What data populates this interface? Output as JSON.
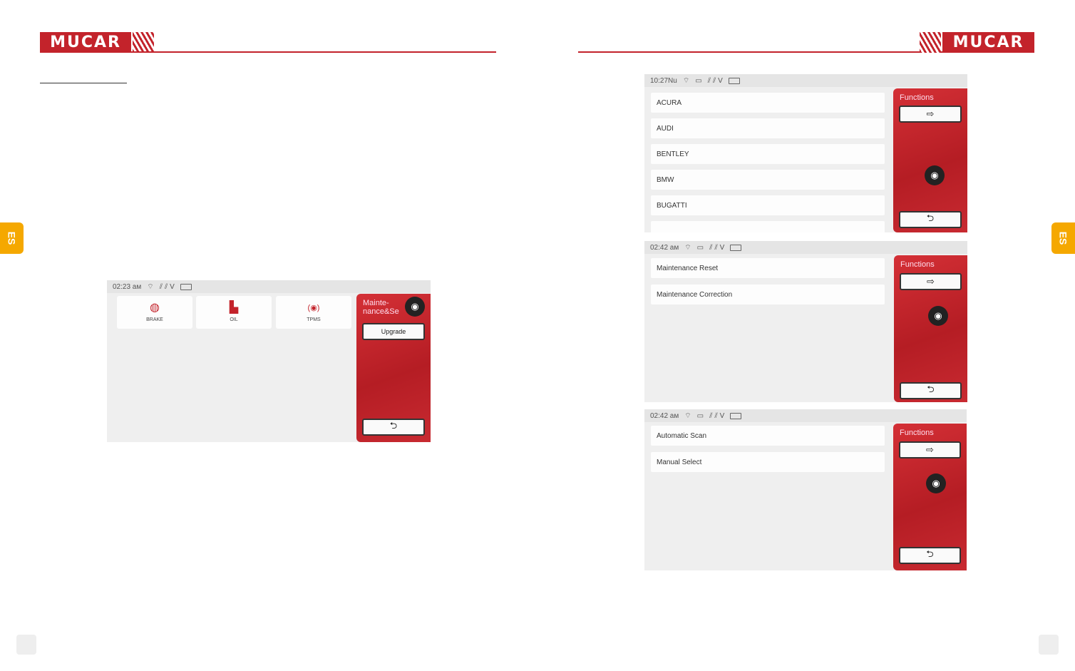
{
  "brand": {
    "logo_text": "MUCAR",
    "accent": "#c3232b",
    "tab_color": "#f5a800"
  },
  "side_tabs": {
    "left": "ES",
    "right": "ES"
  },
  "screen_main": {
    "time": "02:23 ам",
    "panel_title": "Mainte-nance&Se",
    "upgrade_label": "Upgrade",
    "cards": [
      {
        "icon": "brake-disc-icon",
        "glyph": "◍",
        "label": "BRAKE"
      },
      {
        "icon": "oil-can-icon",
        "glyph": "▙",
        "label": "OIL"
      },
      {
        "icon": "tpms-icon",
        "glyph": "(◉)",
        "label": "TPMS"
      }
    ]
  },
  "screen_brands": {
    "time": "10:27Nu",
    "panel_title": "Functions",
    "items": [
      "ACURA",
      "AUDI",
      "BENTLEY",
      "BMW",
      "BUGATTI"
    ]
  },
  "screen_maint": {
    "time": "02:42 ам",
    "panel_title": "Functions",
    "items": [
      "Maintenance Reset",
      "Maintenance Correction"
    ]
  },
  "screen_scan": {
    "time": "02:42 ам",
    "panel_title": "Functions",
    "items": [
      "Automatic Scan",
      "Manual Select"
    ]
  },
  "icons": {
    "exit": "⇨",
    "back": "⮌",
    "camera": "◉",
    "wifi": "⌔",
    "vci": "▭"
  }
}
